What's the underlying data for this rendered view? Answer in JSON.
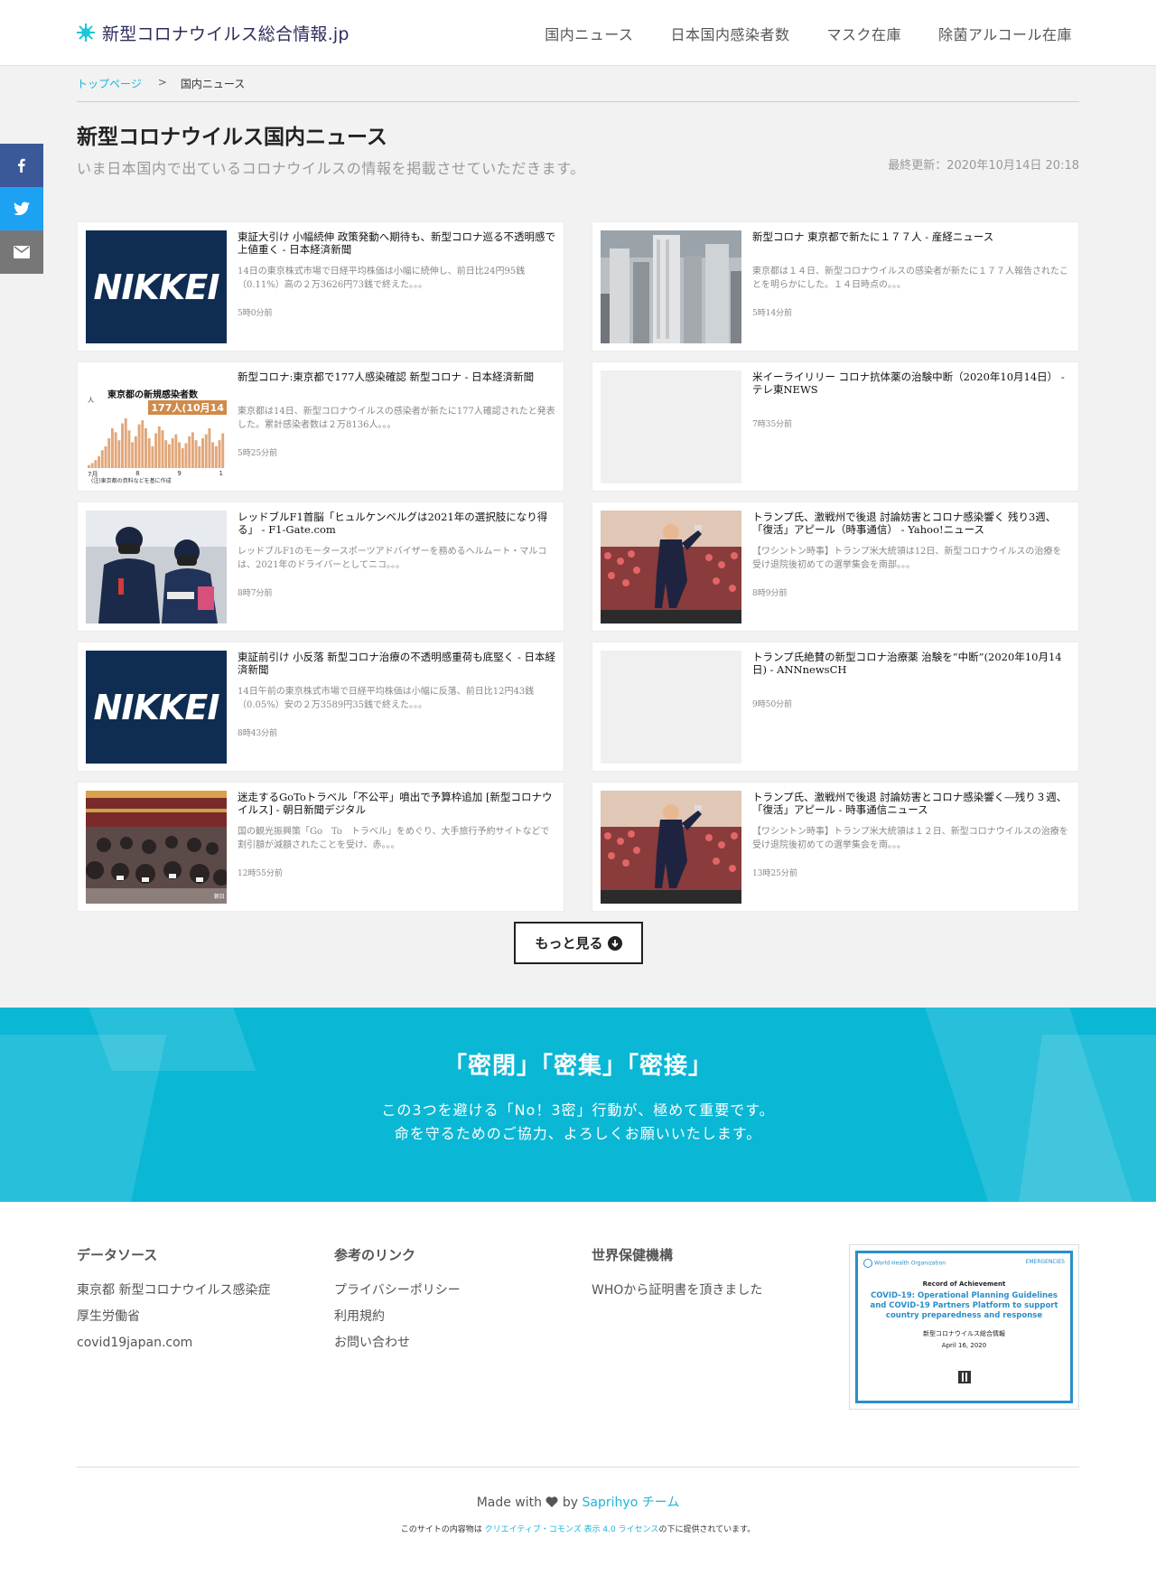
{
  "header": {
    "logo_text": "新型コロナウイルス総合情報.jp",
    "nav": [
      "国内ニュース",
      "日本国内感染者数",
      "マスク在庫",
      "除菌アルコール在庫"
    ]
  },
  "share": {
    "facebook_icon": "f",
    "twitter_icon": "twitter-bird",
    "email_icon": "envelope"
  },
  "breadcrumb": {
    "home": "トップページ",
    "sep": ">",
    "current": "国内ニュース"
  },
  "page": {
    "title": "新型コロナウイルス国内ニュース",
    "subtitle": "いま日本国内で出ているコロナウイルスの情報を掲載させていただきます。",
    "updated": "最終更新：2020年10月14日 20:18"
  },
  "news": [
    {
      "title": "東証大引け 小幅続伸 政策発動へ期待も、新型コロナ巡る不透明感で上値重く - 日本経済新聞",
      "desc": "14日の東京株式市場で日経平均株価は小幅に続伸し、前日比24円95銭（0.11%）高の２万3626円73銭で終えた。。。",
      "time": "5時0分前",
      "thumb": "nikkei"
    },
    {
      "title": "新型コロナ 東京都で新たに１７７人 - 産経ニュース",
      "desc": "東京都は１４日、新型コロナウイルスの感染者が新たに１７７人報告されたことを明らかにした。１４日時点の。。。",
      "time": "5時14分前",
      "thumb": "city"
    },
    {
      "title": "新型コロナ:東京都で177人感染確認 新型コロナ - 日本経済新聞",
      "desc": "東京都は14日、新型コロナウイルスの感染者が新たに177人確認されたと発表した。累計感染者数は２万8136人。。。",
      "time": "5時25分前",
      "thumb": "chart",
      "thumb_title": "東京都の新規感染者数",
      "thumb_badge": "177人(10月14",
      "thumb_axis": [
        "7月",
        "8",
        "9",
        "1"
      ],
      "thumb_note": "(注)東京都の資料などを基に作成",
      "thumb_unit": "人"
    },
    {
      "title": "米イーライリリー コロナ抗体薬の治験中断（2020年10月14日） - テレ東NEWS",
      "desc": "",
      "time": "7時35分前",
      "thumb": "blank"
    },
    {
      "title": "レッドブルF1首脳「ヒュルケンベルグは2021年の選択肢になり得る」 - F1-Gate.com",
      "desc": "レッドブルF1のモータースポーツアドバイザーを務めるヘルムート・マルコは、2021年のドライバーとしてニコ。。。",
      "time": "8時7分前",
      "thumb": "f1"
    },
    {
      "title": "トランプ氏、激戦州で後退 討論妨害とコロナ感染響く 残り3週、「復活」アピール（時事通信） - Yahoo!ニュース",
      "desc": "【ワシントン時事】トランプ米大統領は12日、新型コロナウイルスの治療を受け退院後初めての選挙集会を南部。。。",
      "time": "8時9分前",
      "thumb": "rally"
    },
    {
      "title": "東証前引け 小反落 新型コロナ治療の不透明感重荷も底堅く - 日本経済新聞",
      "desc": "14日午前の東京株式市場で日経平均株価は小幅に反落、前日比12円43銭（0.05%）安の２万3589円35銭で終えた。。。",
      "time": "8時43分前",
      "thumb": "nikkei"
    },
    {
      "title": "トランプ氏絶賛の新型コロナ治療薬 治験を“中断”(2020年10月14日) - ANNnewsCH",
      "desc": "",
      "time": "9時50分前",
      "thumb": "blank"
    },
    {
      "title": "迷走するGoToトラベル「不公平」噴出で予算枠追加 [新型コロナウイルス] - 朝日新聞デジタル",
      "desc": "国の観光振興策「Go　To　トラベル」をめぐり、大手旅行予約サイトなどで割引額が減額されたことを受け、赤。。。",
      "time": "12時55分前",
      "thumb": "crowd",
      "thumb_caption": "朝日"
    },
    {
      "title": "トランプ氏、激戦州で後退 討論妨害とコロナ感染響く―残り３週、「復活」アピール - 時事通信ニュース",
      "desc": "【ワシントン時事】トランプ米大統領は１２日、新型コロナウイルスの治療を受け退院後初めての選挙集会を南。。。",
      "time": "13時25分前",
      "thumb": "rally"
    }
  ],
  "nikkei_logo": "NIKKEI",
  "more_button": "もっと見る",
  "banner": {
    "title": "「密閉」「密集」「密接」",
    "line1": "この3つを避ける「No！3密」行動が、極めて重要です。",
    "line2": "命を守るためのご協力、よろしくお願いいたします。"
  },
  "footer": {
    "col1": {
      "title": "データソース",
      "links": [
        "東京都 新型コロナウイルス感染症",
        "厚生労働省",
        "covid19japan.com"
      ]
    },
    "col2": {
      "title": "参考のリンク",
      "links": [
        "プライバシーポリシー",
        "利用規約",
        "お問い合わせ"
      ]
    },
    "col3": {
      "title": "世界保健機構",
      "links": [
        "WHOから証明書を頂きました"
      ]
    },
    "cert": {
      "org_left": "World Health Organization",
      "org_right": "EMERGENCIES",
      "record": "Record of Achievement",
      "heading": "COVID-19: Operational Planning Guidelines and COVID-19 Partners Platform to support country preparedness and response",
      "recipient": "新型コロナウイルス総合情報",
      "date": "April 16, 2020"
    },
    "made_prefix": "Made with",
    "made_by": "by",
    "team": "Saprihyo チーム",
    "license_prefix": "このサイトの内容物は",
    "license_link": "クリエイティブ・コモンズ 表示 4.0 ライセンス",
    "license_suffix": "の下に提供されています。"
  }
}
